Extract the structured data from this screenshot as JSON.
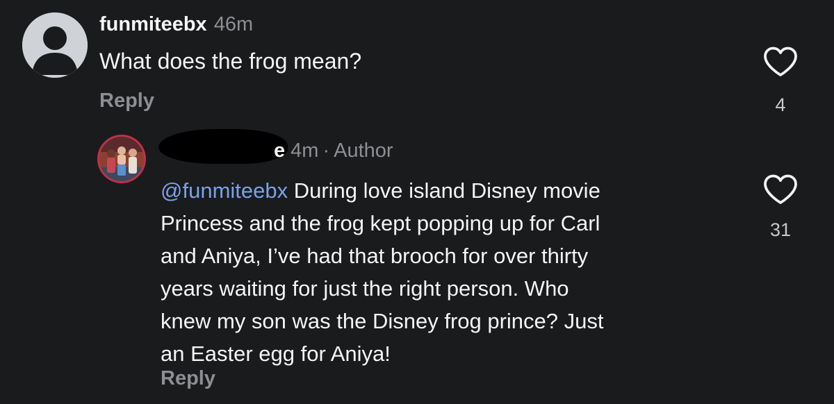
{
  "comments": [
    {
      "username": "funmiteebx",
      "time": "46m",
      "text": "What does the frog mean?",
      "reply_label": "Reply",
      "likes": "4",
      "avatar_icon": "default-profile-icon"
    }
  ],
  "reply": {
    "username_visible": "e",
    "username_redacted": true,
    "time": "4m",
    "separator": "·",
    "badge": "Author",
    "mention": "@funmiteebx",
    "text_lines": [
      " During love island Disney movie",
      "Princess and the frog kept popping up for Carl",
      "and Aniya, I’ve had that brooch for over thirty",
      "years waiting for just the right person. Who",
      "knew my son was the Disney frog prince? Just",
      "an Easter egg for Aniya!"
    ],
    "reply_label": "Reply",
    "likes": "31",
    "avatar_icon": "profile-photo"
  },
  "colors": {
    "background": "#1a1b1d",
    "text": "#f5f5f5",
    "muted": "#8e8e93",
    "mention": "#7aa2e8",
    "avatar_ring": "#c03048"
  },
  "icons": {
    "like": "heart-outline-icon"
  }
}
